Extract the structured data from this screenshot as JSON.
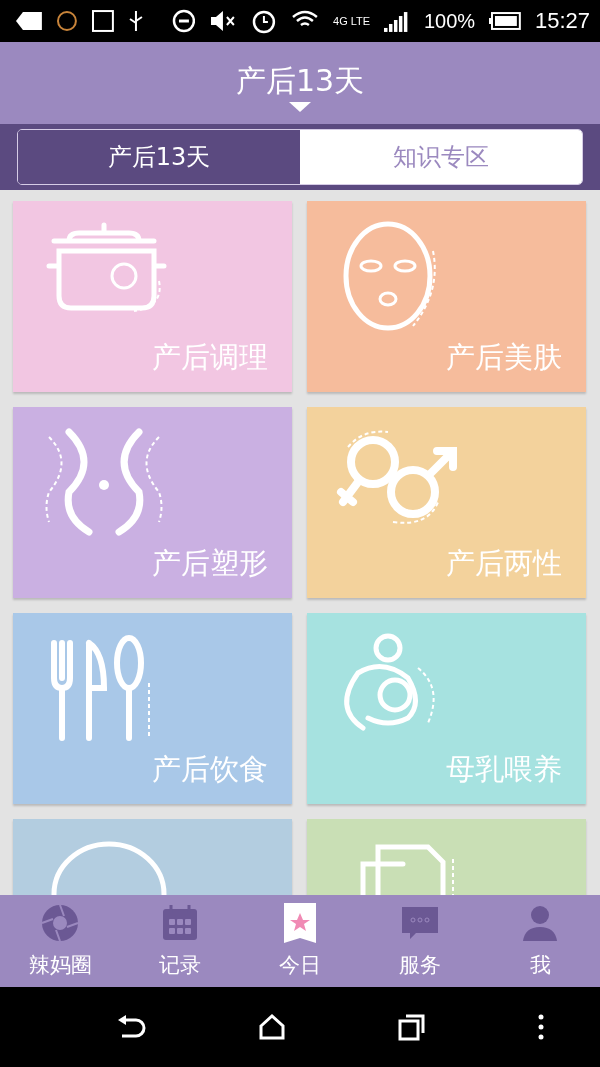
{
  "status_bar": {
    "network": "4G LTE",
    "battery": "100%",
    "time": "15:27"
  },
  "header": {
    "title": "产后13天"
  },
  "tabs": [
    {
      "label": "产后13天",
      "selected": true
    },
    {
      "label": "知识专区",
      "selected": false
    }
  ],
  "cards": [
    {
      "label": "产后调理",
      "color": "#f2c6e2"
    },
    {
      "label": "产后美肤",
      "color": "#f6bc9c"
    },
    {
      "label": "产后塑形",
      "color": "#cab0e2"
    },
    {
      "label": "产后两性",
      "color": "#f3d29c"
    },
    {
      "label": "产后饮食",
      "color": "#a9c8e8"
    },
    {
      "label": "母乳喂养",
      "color": "#a6e2e0"
    },
    {
      "color": "#b3cde0"
    },
    {
      "color": "#c9dfb5"
    }
  ],
  "bottom_nav": [
    {
      "label": "辣妈圈",
      "selected": false
    },
    {
      "label": "记录",
      "selected": false
    },
    {
      "label": "今日",
      "selected": true
    },
    {
      "label": "服务",
      "selected": false
    },
    {
      "label": "我",
      "selected": false
    }
  ]
}
